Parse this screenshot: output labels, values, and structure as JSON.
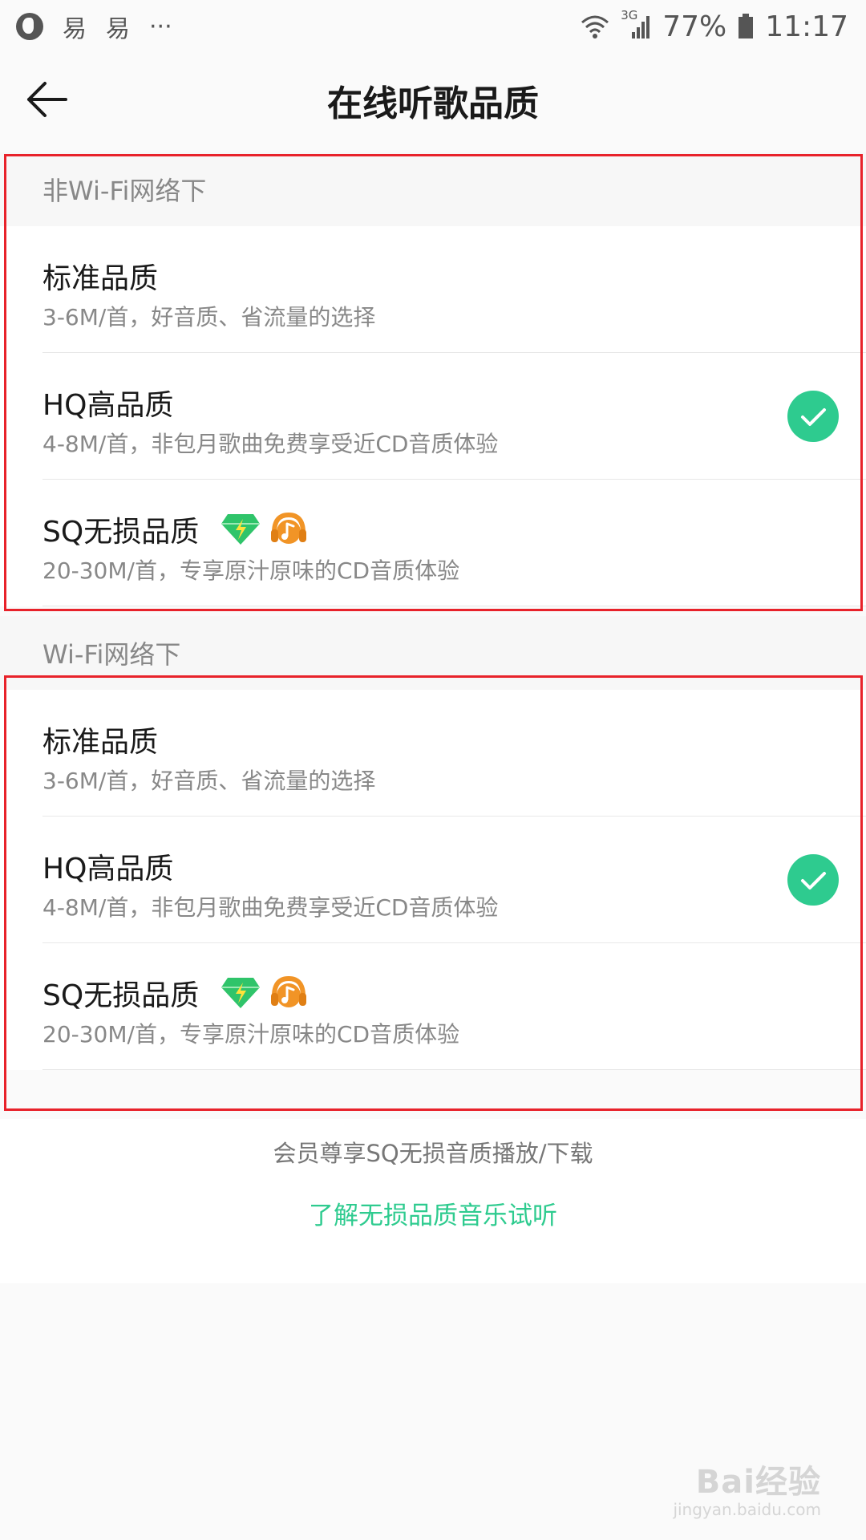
{
  "status_bar": {
    "notif_1": "易",
    "notif_2": "易",
    "more": "···",
    "network": "3G",
    "battery": "77%",
    "time": "11:17"
  },
  "header": {
    "title": "在线听歌品质"
  },
  "sections": [
    {
      "header": "非Wi-Fi网络下",
      "options": [
        {
          "title": "标准品质",
          "desc": "3-6M/首，好音质、省流量的选择",
          "selected": false
        },
        {
          "title": "HQ高品质",
          "desc": "4-8M/首，非包月歌曲免费享受近CD音质体验",
          "selected": true
        },
        {
          "title": "SQ无损品质",
          "desc": "20-30M/首，专享原汁原味的CD音质体验",
          "selected": false
        }
      ]
    },
    {
      "header": "Wi-Fi网络下",
      "options": [
        {
          "title": "标准品质",
          "desc": "3-6M/首，好音质、省流量的选择",
          "selected": false
        },
        {
          "title": "HQ高品质",
          "desc": "4-8M/首，非包月歌曲免费享受近CD音质体验",
          "selected": true
        },
        {
          "title": "SQ无损品质",
          "desc": "20-30M/首，专享原汁原味的CD音质体验",
          "selected": false
        }
      ]
    }
  ],
  "footer": {
    "note": "会员尊享SQ无损音质播放/下载",
    "link": "了解无损品质音乐试听"
  },
  "watermark": {
    "brand": "Bai经验",
    "url": "jingyan.baidu.com"
  },
  "colors": {
    "accent": "#2ecb8f",
    "highlight": "#e8222a"
  },
  "icons": {
    "back": "arrow-left-icon",
    "selected": "check-circle-icon",
    "vip": "green-diamond-icon",
    "music": "orange-headphones-icon"
  }
}
